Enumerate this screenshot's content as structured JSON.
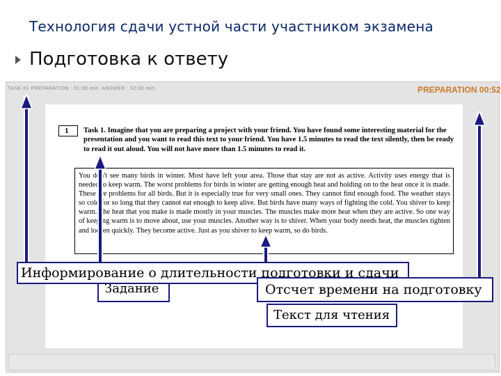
{
  "slide": {
    "title": "Технология сдачи устной части участником экзамена",
    "subtitle": "Подготовка к ответу"
  },
  "exam": {
    "task_info": "TASK #1    PREPARATION : 01:30 min.  ANSWER : 02:00 min.",
    "timer": "PREPARATION 00:52",
    "task_number": "1",
    "instruction": "Task 1. Imagine that you are preparing a project with your friend. You have found some interesting material for the presentation and you want to read this text to your friend. You have 1.5 minutes to read the text silently, then be ready to read it out aloud. You will not have more than 1.5 minutes to read it.",
    "reading_text": "You don't see many birds in winter. Most have left your area. Those that stay are not as active. Activity uses energy that is needed to keep warm. The worst problems for birds in winter are getting enough heat and holding on to the heat once it is made. These are problems for all birds. But it is especially true for very small ones. They cannot find enough food. The weather stays so cold for so long that they cannot eat enough to keep alive. But birds have many ways of fighting the cold. You shiver to keep warm. The heat that you make is made mostly in your muscles. The muscles make more heat when they are active. So one way of keeping warm is to move about, use your muscles. Another way is to shiver. When your body needs heat, the muscles tighten and loosen quickly. They become active. Just as you shiver to keep warm, so do birds."
  },
  "callouts": {
    "info": "Информирование о длительности подготовки и сдачи",
    "task": "Задание",
    "timer": "Отсчет времени на подготовку",
    "text": "Текст для чтения"
  },
  "colors": {
    "title": "#0a2a6b",
    "timer": "#c87a2a",
    "arrow": "#1a1a80"
  }
}
